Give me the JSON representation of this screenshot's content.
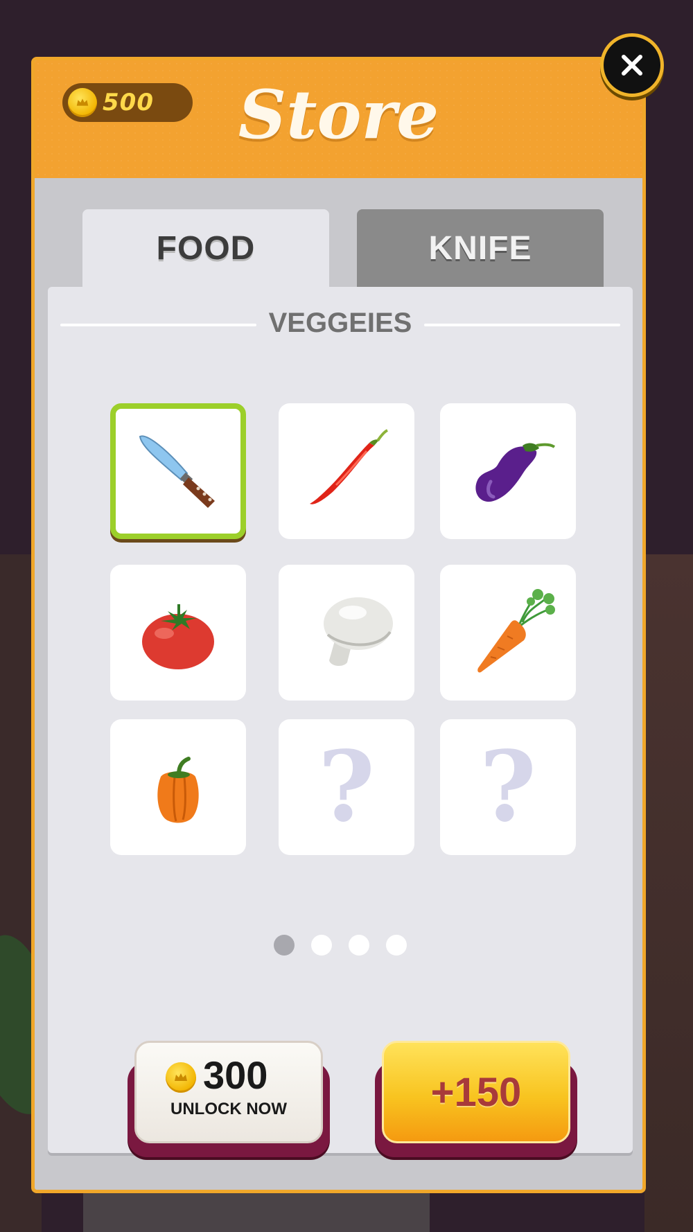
{
  "header": {
    "coins": "500",
    "title": "Store"
  },
  "tabs": [
    {
      "label": "FOOD",
      "active": true
    },
    {
      "label": "KNIFE",
      "active": false
    }
  ],
  "section": {
    "title": "VEGGEIES"
  },
  "items": [
    {
      "name": "knife",
      "icon": "knife-icon",
      "selected": true,
      "locked": false
    },
    {
      "name": "chili-pepper",
      "icon": "chili-pepper-icon",
      "selected": false,
      "locked": false
    },
    {
      "name": "eggplant",
      "icon": "eggplant-icon",
      "selected": false,
      "locked": false
    },
    {
      "name": "tomato",
      "icon": "tomato-icon",
      "selected": false,
      "locked": false
    },
    {
      "name": "mushroom",
      "icon": "mushroom-icon",
      "selected": false,
      "locked": false
    },
    {
      "name": "carrot",
      "icon": "carrot-icon",
      "selected": false,
      "locked": false
    },
    {
      "name": "bell-pepper",
      "icon": "bell-pepper-icon",
      "selected": false,
      "locked": false
    },
    {
      "name": "locked",
      "icon": "question-mark-icon",
      "selected": false,
      "locked": true,
      "label": "?"
    },
    {
      "name": "locked",
      "icon": "question-mark-icon",
      "selected": false,
      "locked": true,
      "label": "?"
    }
  ],
  "pagination": {
    "pages": 4,
    "current": 1
  },
  "buttons": {
    "unlock_price": "300",
    "unlock_label": "UNLOCK NOW",
    "reward_label": "+150"
  },
  "colors": {
    "header": "#f3a230",
    "panel_border": "#f0a72a",
    "selected_border": "#9ccf2a",
    "coin": "#f2b400",
    "reward_button": "#f8c420"
  }
}
